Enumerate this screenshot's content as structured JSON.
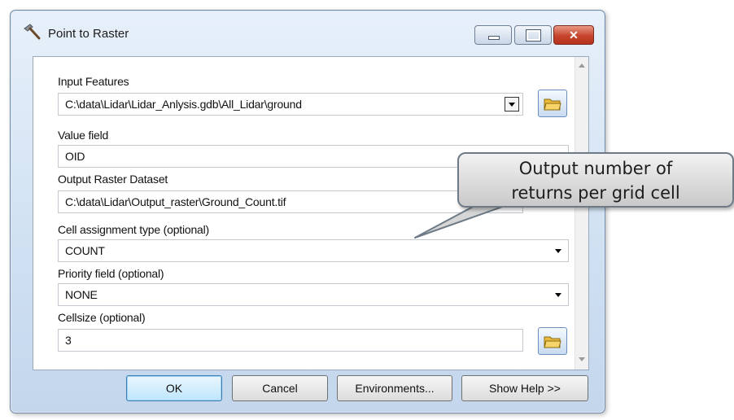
{
  "window": {
    "title": "Point to Raster",
    "icon": "hammer-icon"
  },
  "fields": {
    "input_features": {
      "label": "Input Features",
      "value": "C:\\data\\Lidar\\Lidar_Anlysis.gdb\\All_Lidar\\ground"
    },
    "value_field": {
      "label": "Value field",
      "value": "OID"
    },
    "output_raster": {
      "label": "Output Raster Dataset",
      "value": "C:\\data\\Lidar\\Output_raster\\Ground_Count.tif"
    },
    "cell_assignment": {
      "label": "Cell assignment type (optional)",
      "value": "COUNT"
    },
    "priority_field": {
      "label": "Priority field (optional)",
      "value": "NONE"
    },
    "cellsize": {
      "label": "Cellsize (optional)",
      "value": "3"
    }
  },
  "buttons": {
    "ok": "OK",
    "cancel": "Cancel",
    "environments": "Environments...",
    "show_help": "Show Help >>"
  },
  "callout": {
    "line1": "Output number of",
    "line2": "returns per grid cell"
  }
}
